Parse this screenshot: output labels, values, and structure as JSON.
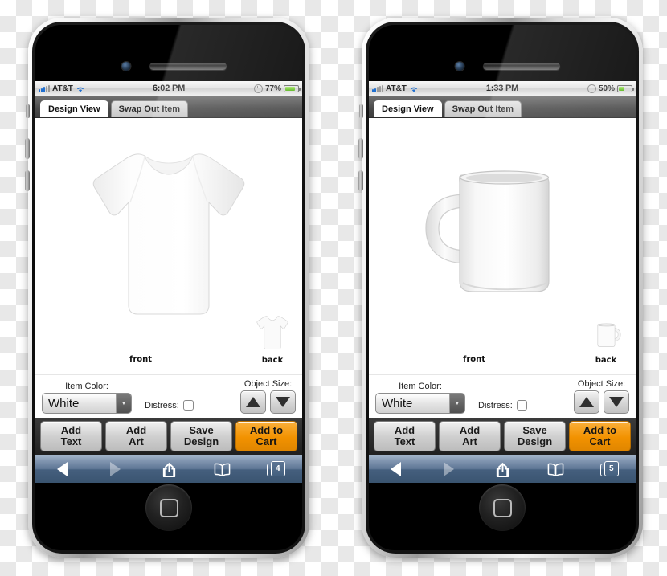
{
  "phones": [
    {
      "id": "phone-left",
      "status": {
        "carrier": "AT&T",
        "time": "6:02 PM",
        "battery_pct": "77%",
        "battery_level": 77
      },
      "tabs": [
        {
          "label": "Design View",
          "active": true
        },
        {
          "label": "Swap Out Item",
          "active": false
        }
      ],
      "product": {
        "type": "tshirt",
        "front_label": "front",
        "back_label": "back"
      },
      "controls": {
        "item_color_label": "Item Color:",
        "item_color_value": "White",
        "item_color_options": [
          "White"
        ],
        "distress_label": "Distress:",
        "distress_checked": false,
        "object_size_label": "Object Size:",
        "size_up_icon": "triangle-up-icon",
        "size_down_icon": "triangle-down-icon"
      },
      "actions": [
        {
          "label": "Add\nText",
          "line1": "Add",
          "line2": "Text",
          "primary": false
        },
        {
          "label": "Add\nArt",
          "line1": "Add",
          "line2": "Art",
          "primary": false
        },
        {
          "label": "Save\nDesign",
          "line1": "Save",
          "line2": "Design",
          "primary": false
        },
        {
          "label": "Add to\nCart",
          "line1": "Add to",
          "line2": "Cart",
          "primary": true
        }
      ],
      "safari": {
        "back_icon": "back-arrow-icon",
        "forward_icon": "forward-arrow-icon",
        "share_icon": "share-icon",
        "bookmarks_icon": "bookmarks-book-icon",
        "pages_icon": "pages-icon",
        "pages_count": "4"
      }
    },
    {
      "id": "phone-right",
      "status": {
        "carrier": "AT&T",
        "time": "1:33 PM",
        "battery_pct": "50%",
        "battery_level": 50
      },
      "tabs": [
        {
          "label": "Design View",
          "active": true
        },
        {
          "label": "Swap Out Item",
          "active": false
        }
      ],
      "product": {
        "type": "mug",
        "front_label": "front",
        "back_label": "back"
      },
      "controls": {
        "item_color_label": "Item Color:",
        "item_color_value": "White",
        "item_color_options": [
          "White"
        ],
        "distress_label": "Distress:",
        "distress_checked": false,
        "object_size_label": "Object Size:",
        "size_up_icon": "triangle-up-icon",
        "size_down_icon": "triangle-down-icon"
      },
      "actions": [
        {
          "label": "Add\nText",
          "line1": "Add",
          "line2": "Text",
          "primary": false
        },
        {
          "label": "Add\nArt",
          "line1": "Add",
          "line2": "Art",
          "primary": false
        },
        {
          "label": "Save\nDesign",
          "line1": "Save",
          "line2": "Design",
          "primary": false
        },
        {
          "label": "Add to\nCart",
          "line1": "Add to",
          "line2": "Cart",
          "primary": true
        }
      ],
      "safari": {
        "back_icon": "back-arrow-icon",
        "forward_icon": "forward-arrow-icon",
        "share_icon": "share-icon",
        "bookmarks_icon": "bookmarks-book-icon",
        "pages_icon": "pages-icon",
        "pages_count": "5"
      }
    }
  ],
  "colors": {
    "accent_orange": "#f29200",
    "signal_blue": "#1f6fd0",
    "battery_green": "#54b317",
    "toolbar_blue": "#5c7493"
  }
}
